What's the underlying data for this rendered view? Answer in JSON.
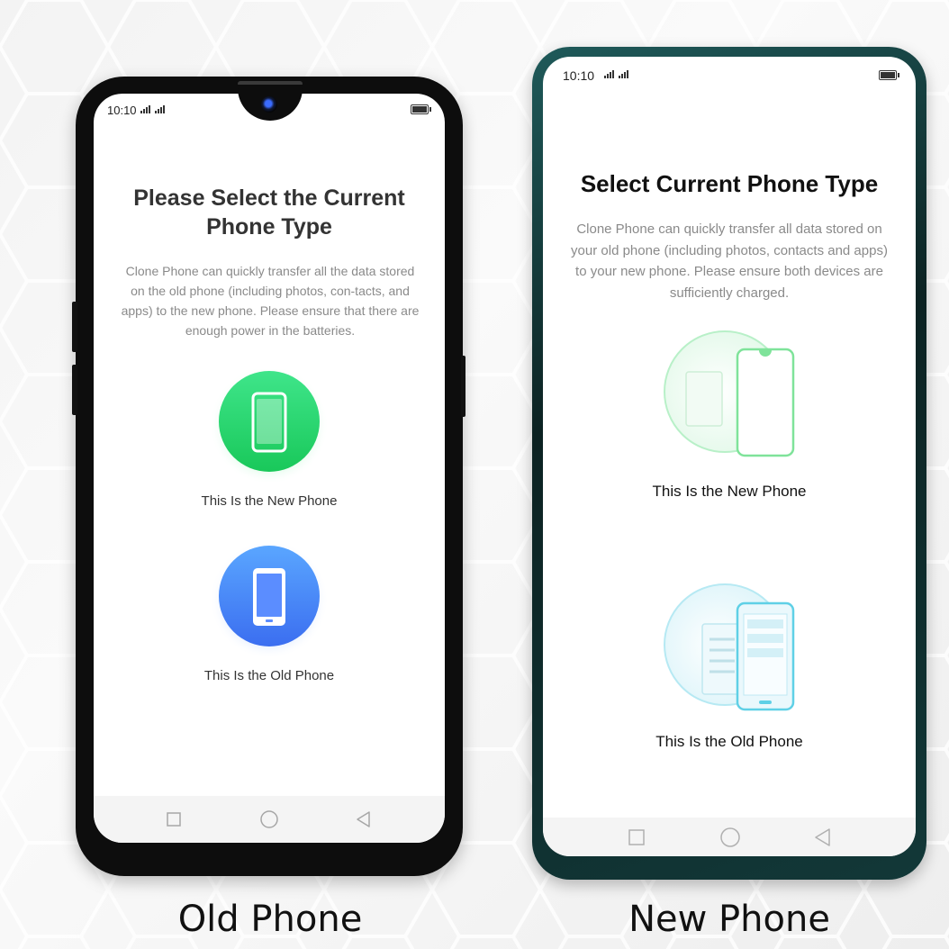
{
  "old_phone": {
    "status": {
      "time": "10:10"
    },
    "title": "Please Select the Current Phone Type",
    "description": "Clone Phone can quickly transfer all the data stored on the old phone (including photos, con-tacts, and apps) to the new phone. Please ensure that there are enough power in the batteries.",
    "options": [
      {
        "label": "This Is the New Phone",
        "icon": "phone-icon",
        "color": "#2fd66f"
      },
      {
        "label": "This Is the Old Phone",
        "icon": "phone-icon",
        "color": "#3d86f5"
      }
    ],
    "nav": [
      "recent-apps-icon",
      "home-icon",
      "back-icon"
    ]
  },
  "new_phone": {
    "status": {
      "time": "10:10"
    },
    "title": "Select Current Phone Type",
    "description": "Clone Phone can quickly transfer all data stored on your old phone (including photos, contacts and apps) to your new phone. Please ensure both devices are sufficiently charged.",
    "options": [
      {
        "label": "This Is the New Phone",
        "icon": "new-phone-illustration",
        "color": "#7fe39a"
      },
      {
        "label": "This Is the Old Phone",
        "icon": "old-phone-illustration",
        "color": "#5fd0e6"
      }
    ],
    "nav": [
      "recent-apps-icon",
      "home-icon",
      "back-icon"
    ]
  },
  "captions": {
    "left": "Old Phone",
    "right": "New Phone"
  }
}
